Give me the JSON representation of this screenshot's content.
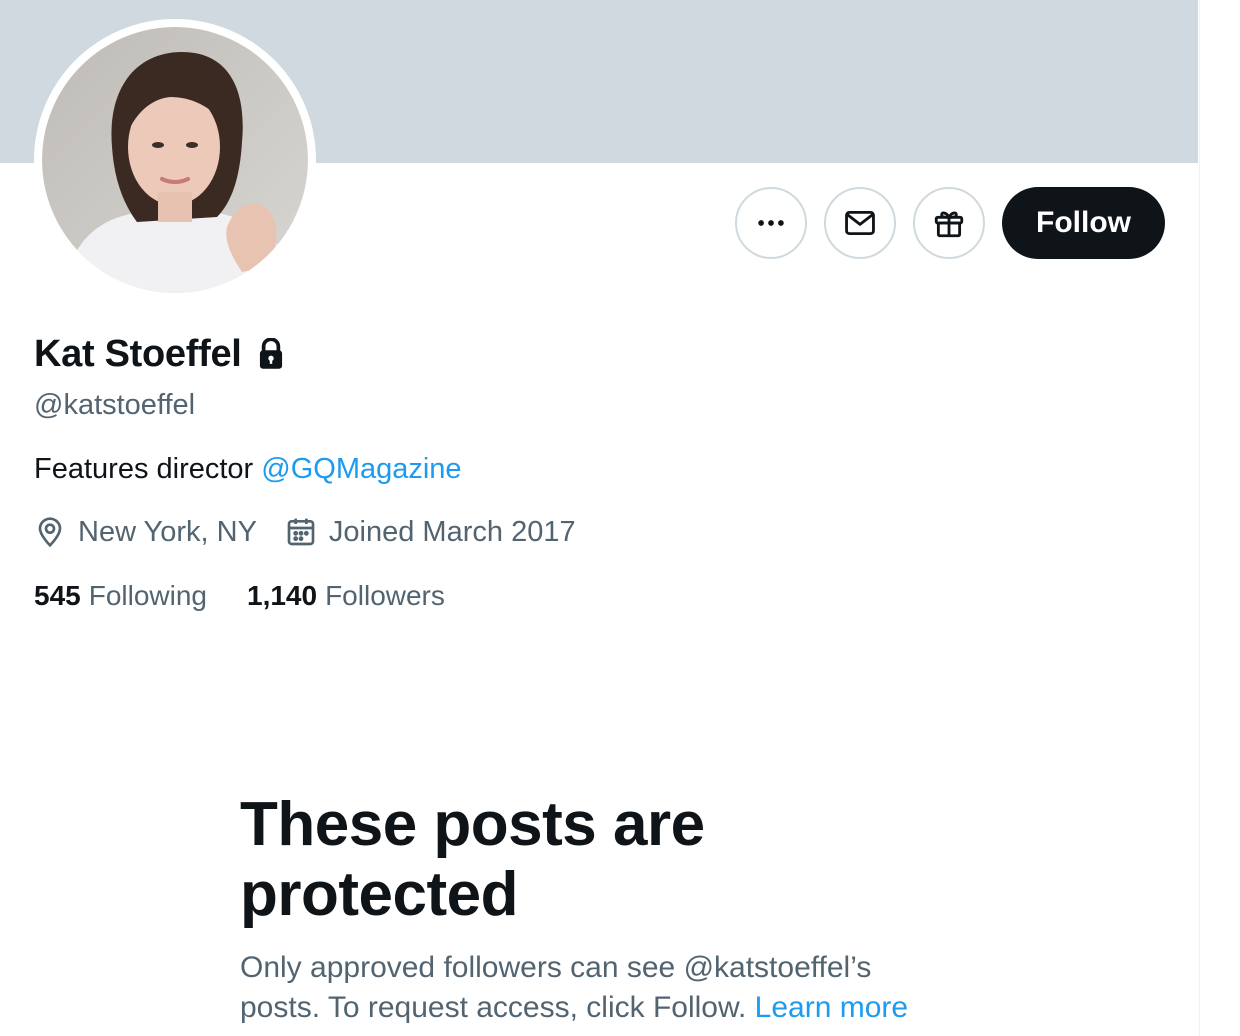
{
  "colors": {
    "banner": "#cfd9df",
    "accent_link": "#1d9bf0",
    "primary_text": "#0f1419",
    "secondary_text": "#536471",
    "button_border": "#cfd9de",
    "follow_bg": "#0f1419"
  },
  "profile": {
    "display_name": "Kat Stoeffel",
    "protected_icon": "lock-icon",
    "handle": "@katstoeffel",
    "bio_text": "Features director ",
    "bio_mention": "@GQMagazine",
    "location": "New York, NY",
    "location_icon": "location-pin-icon",
    "joined": "Joined March 2017",
    "joined_icon": "calendar-icon"
  },
  "actions": {
    "more_icon": "more-icon",
    "message_icon": "message-icon",
    "gift_icon": "gift-icon",
    "follow_label": "Follow"
  },
  "stats": {
    "following_count": "545",
    "following_label": "Following",
    "followers_count": "1,140",
    "followers_label": "Followers"
  },
  "protected_notice": {
    "title": "These posts are protected",
    "description": "Only approved followers can see @katstoeffel’s posts. To request access, click Follow. ",
    "learn_more": "Learn more"
  }
}
